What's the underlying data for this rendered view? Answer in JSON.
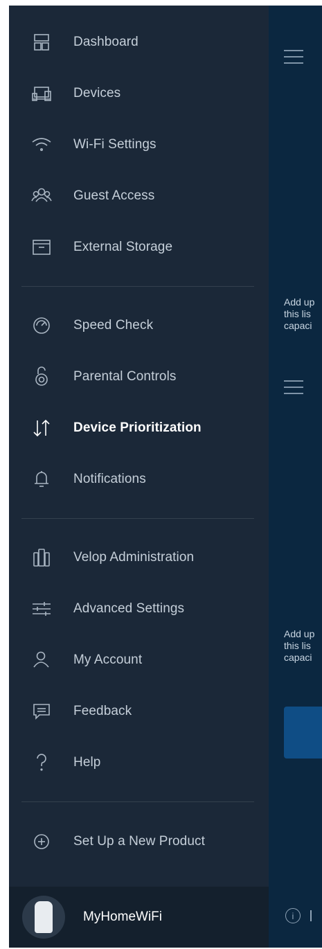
{
  "menu": {
    "section1": [
      {
        "label": "Dashboard",
        "icon": "dashboard-icon"
      },
      {
        "label": "Devices",
        "icon": "devices-icon"
      },
      {
        "label": "Wi-Fi Settings",
        "icon": "wifi-icon"
      },
      {
        "label": "Guest Access",
        "icon": "guest-users-icon"
      },
      {
        "label": "External Storage",
        "icon": "storage-box-icon"
      }
    ],
    "section2": [
      {
        "label": "Speed Check",
        "icon": "speedometer-icon"
      },
      {
        "label": "Parental Controls",
        "icon": "lock-icon"
      },
      {
        "label": "Device Prioritization",
        "icon": "priority-arrows-icon",
        "active": true
      },
      {
        "label": "Notifications",
        "icon": "bell-icon"
      }
    ],
    "section3": [
      {
        "label": "Velop Administration",
        "icon": "velop-nodes-icon"
      },
      {
        "label": "Advanced Settings",
        "icon": "sliders-icon"
      },
      {
        "label": "My Account",
        "icon": "user-icon"
      },
      {
        "label": "Feedback",
        "icon": "chat-bubble-icon"
      },
      {
        "label": "Help",
        "icon": "question-icon"
      }
    ],
    "section4": [
      {
        "label": "Set Up a New Product",
        "icon": "plus-circle-icon"
      }
    ]
  },
  "footer": {
    "network_name": "MyHomeWiFi"
  },
  "background": {
    "blurb1": [
      "Add up",
      "this lis",
      "capaci"
    ],
    "blurb2": [
      "Add up",
      "this lis",
      "capaci"
    ]
  },
  "colors": {
    "drawer": "#1b2838",
    "active": "#ffffff",
    "accent": "#0f4d85"
  }
}
